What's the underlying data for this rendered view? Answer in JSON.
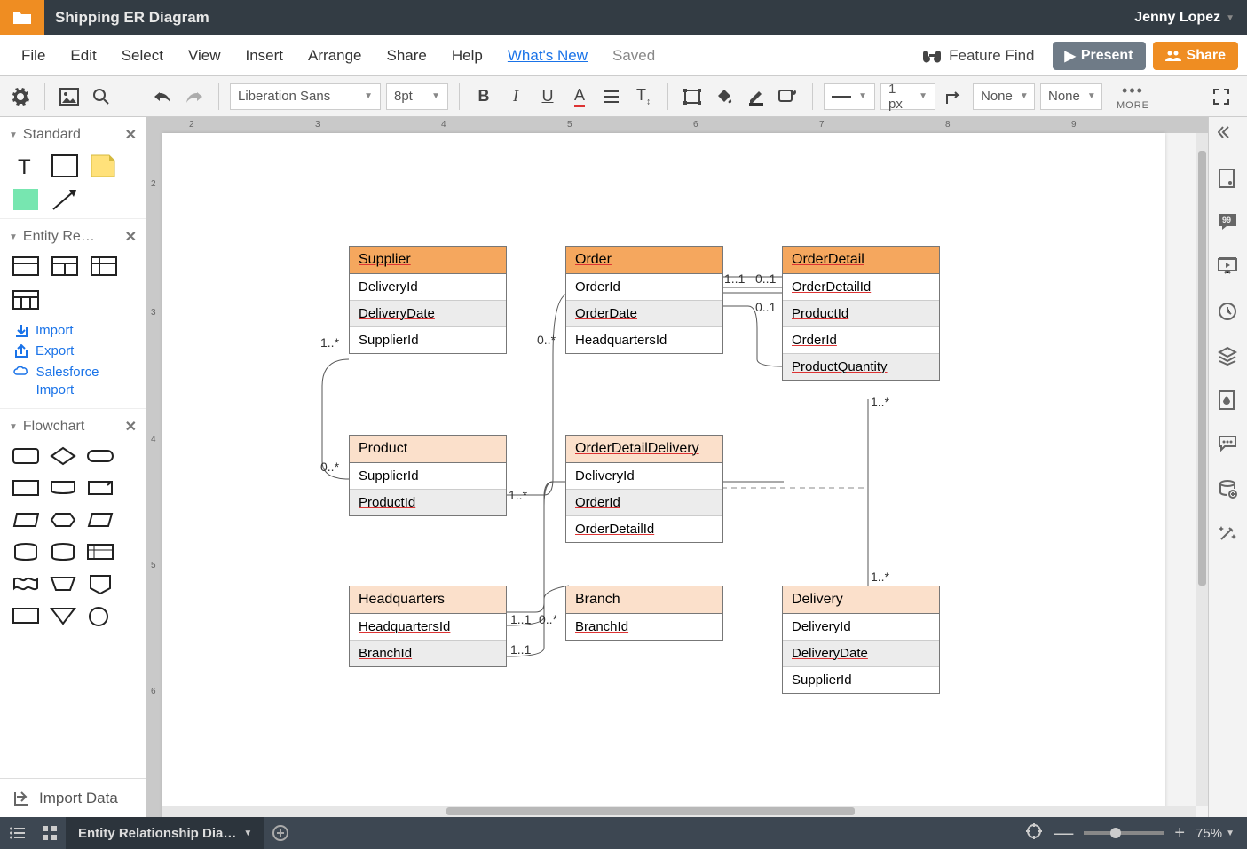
{
  "header": {
    "title": "Shipping ER Diagram",
    "user": "Jenny Lopez"
  },
  "menu": {
    "file": "File",
    "edit": "Edit",
    "select": "Select",
    "view": "View",
    "insert": "Insert",
    "arrange": "Arrange",
    "share": "Share",
    "help": "Help",
    "whatsnew": "What's New",
    "saved": "Saved",
    "feature": "Feature Find",
    "present": "Present",
    "share_btn": "Share"
  },
  "toolbar": {
    "font": "Liberation Sans",
    "fontsize": "8pt",
    "linewidth": "1 px",
    "linestyle": "None",
    "arrowstyle": "None",
    "more": "MORE"
  },
  "left": {
    "s1": "Standard",
    "s2": "Entity Re…",
    "s3": "Flowchart",
    "import": "Import",
    "export": "Export",
    "sfimport": "Salesforce Import",
    "importdata": "Import Data"
  },
  "bottom": {
    "tab": "Entity Relationship Dia…",
    "zoom": "75%"
  },
  "entities": {
    "supplier": {
      "title": "Supplier",
      "rows": [
        "DeliveryId",
        "DeliveryDate",
        "SupplierId"
      ]
    },
    "product": {
      "title": "Product",
      "rows": [
        "SupplierId",
        "ProductId"
      ]
    },
    "headquarters": {
      "title": "Headquarters",
      "rows": [
        "HeadquartersId",
        "BranchId"
      ]
    },
    "order": {
      "title": "Order",
      "rows": [
        "OrderId",
        "OrderDate",
        "HeadquartersId"
      ]
    },
    "odd": {
      "title": "OrderDetailDelivery",
      "rows": [
        "DeliveryId",
        "OrderId",
        "OrderDetailId"
      ]
    },
    "branch": {
      "title": "Branch",
      "rows": [
        "BranchId"
      ]
    },
    "orderdetail": {
      "title": "OrderDetail",
      "rows": [
        "OrderDetailId",
        "ProductId",
        "OrderId",
        "ProductQuantity"
      ]
    },
    "delivery": {
      "title": "Delivery",
      "rows": [
        "DeliveryId",
        "DeliveryDate",
        "SupplierId"
      ]
    }
  },
  "cardinalities": {
    "c1": "1..*",
    "c2": "0..*",
    "c3": "1..*",
    "c4": "0..*",
    "c5": "1..1",
    "c6": "0..1",
    "c7": "0..1",
    "c8": "1..*",
    "c9": "1..*",
    "c10": "1..1",
    "c11": "0..*",
    "c12": "1..1"
  }
}
